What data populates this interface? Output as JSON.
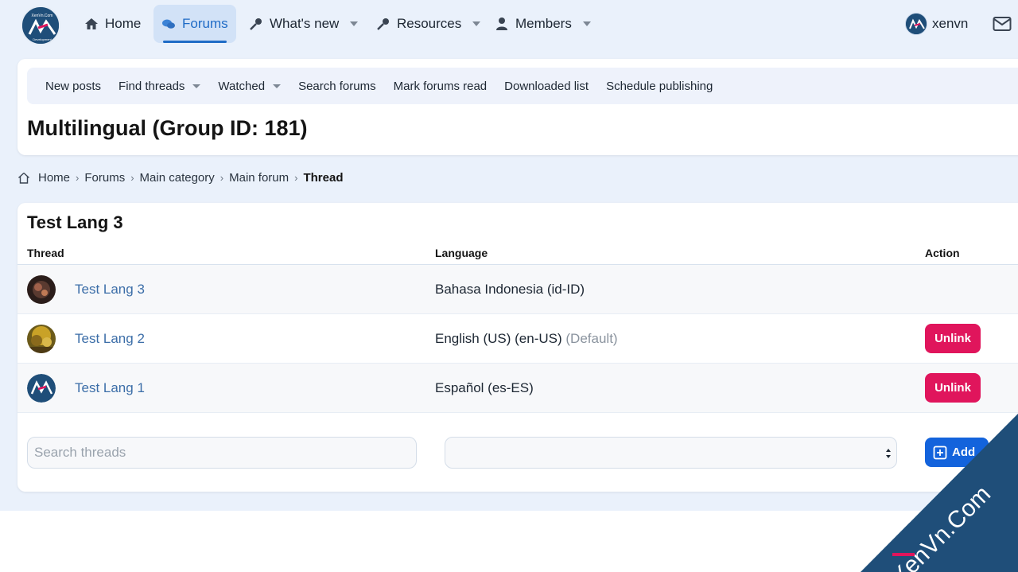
{
  "nav": {
    "items": [
      {
        "label": "Home",
        "icon": "home-icon"
      },
      {
        "label": "Forums",
        "icon": "forums-icon",
        "active": true
      },
      {
        "label": "What's new",
        "icon": "key-icon"
      },
      {
        "label": "Resources",
        "icon": "key-icon"
      },
      {
        "label": "Members",
        "icon": "user-icon"
      }
    ],
    "username": "xenvn"
  },
  "subnav": {
    "items": [
      "New posts",
      "Find threads",
      "Watched",
      "Search forums",
      "Mark forums read",
      "Downloaded list",
      "Schedule publishing"
    ]
  },
  "page_title": "Multilingual (Group ID: 181)",
  "breadcrumb": [
    "Home",
    "Forums",
    "Main category",
    "Main forum",
    "Thread"
  ],
  "block": {
    "title": "Test Lang 3",
    "columns": {
      "thread": "Thread",
      "language": "Language",
      "action": "Action"
    },
    "rows": [
      {
        "thread": "Test Lang 3",
        "language": "Bahasa Indonesia (id-ID)",
        "note": "",
        "action": ""
      },
      {
        "thread": "Test Lang 2",
        "language": "English (US) (en-US)",
        "note": "(Default)",
        "action": "Unlink"
      },
      {
        "thread": "Test Lang 1",
        "language": "Español (es-ES)",
        "note": "",
        "action": "Unlink"
      }
    ],
    "search_placeholder": "Search threads",
    "add_label": "Add"
  },
  "watermark": "XenVn.Com",
  "colors": {
    "accent": "#1f6bc6",
    "danger": "#e0155c",
    "primary": "#1363dc",
    "background": "#eaf1fb"
  }
}
